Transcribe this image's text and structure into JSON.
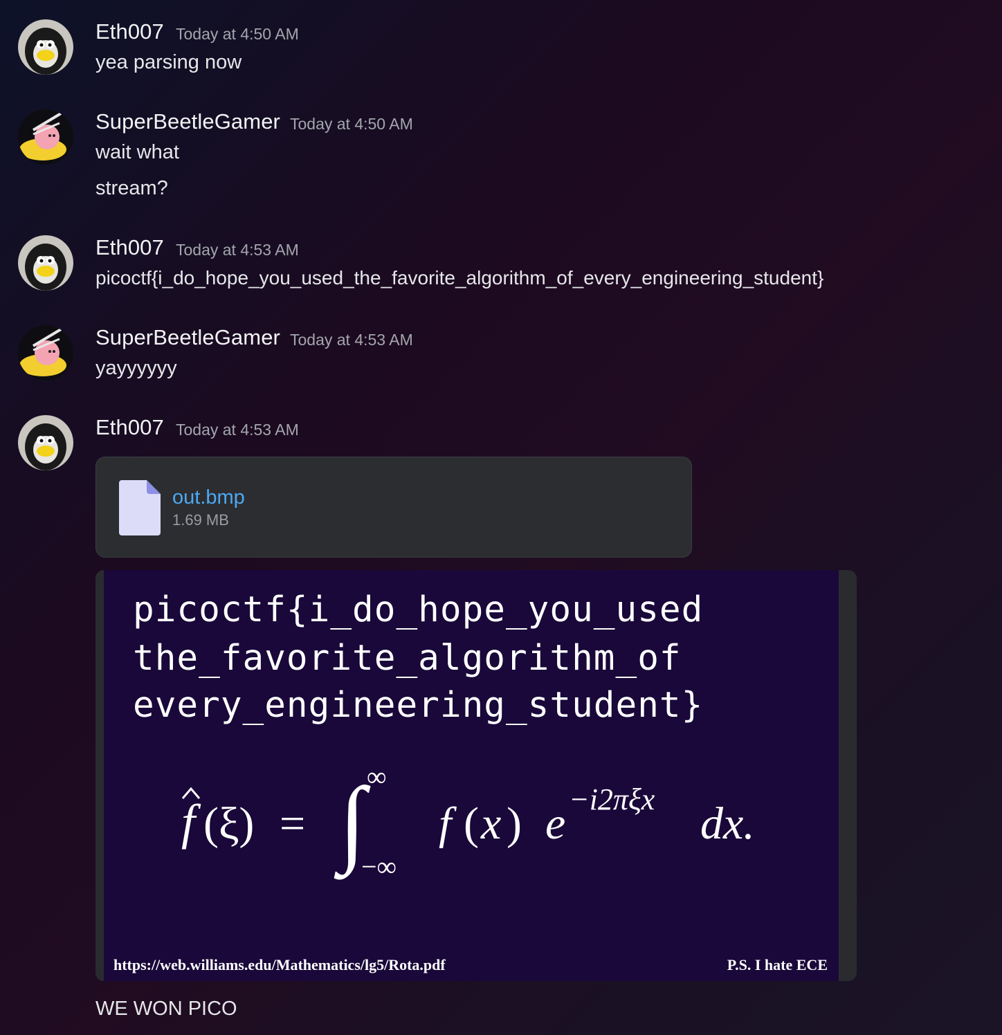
{
  "messages": [
    {
      "author": "Eth007",
      "time": "Today at 4:50 AM",
      "lines": [
        "yea parsing now"
      ]
    },
    {
      "author": "SuperBeetleGamer",
      "time": "Today at 4:50 AM",
      "lines": [
        "wait what",
        "stream?"
      ]
    },
    {
      "author": "Eth007",
      "time": "Today at 4:53 AM",
      "lines": [
        "picoctf{i_do_hope_you_used_the_favorite_algorithm_of_every_engineering_student}"
      ]
    },
    {
      "author": "SuperBeetleGamer",
      "time": "Today at 4:53 AM",
      "lines": [
        "yayyyyyy"
      ]
    },
    {
      "author": "Eth007",
      "time": "Today at 4:53 AM",
      "lines": [
        "WE WON PICO"
      ]
    }
  ],
  "attachment": {
    "file_name": "out.bmp",
    "file_size": "1.69 MB",
    "icon": "file-icon"
  },
  "image": {
    "flag_lines": [
      "picoctf{i_do_hope_you_used",
      "the_favorite_algorithm_of",
      "every_engineering_student}"
    ],
    "formula": "f̂(ξ) = ∫_{−∞}^{∞} f(x) e^{−i2πξx} dx.",
    "link": "https://web.williams.edu/Mathematics/lg5/Rota.pdf",
    "ps": "P.S. I hate ECE"
  },
  "colors": {
    "link": "#4ea9f2",
    "image_bg": "#190839",
    "attachment_bg": "#2b2d31"
  }
}
